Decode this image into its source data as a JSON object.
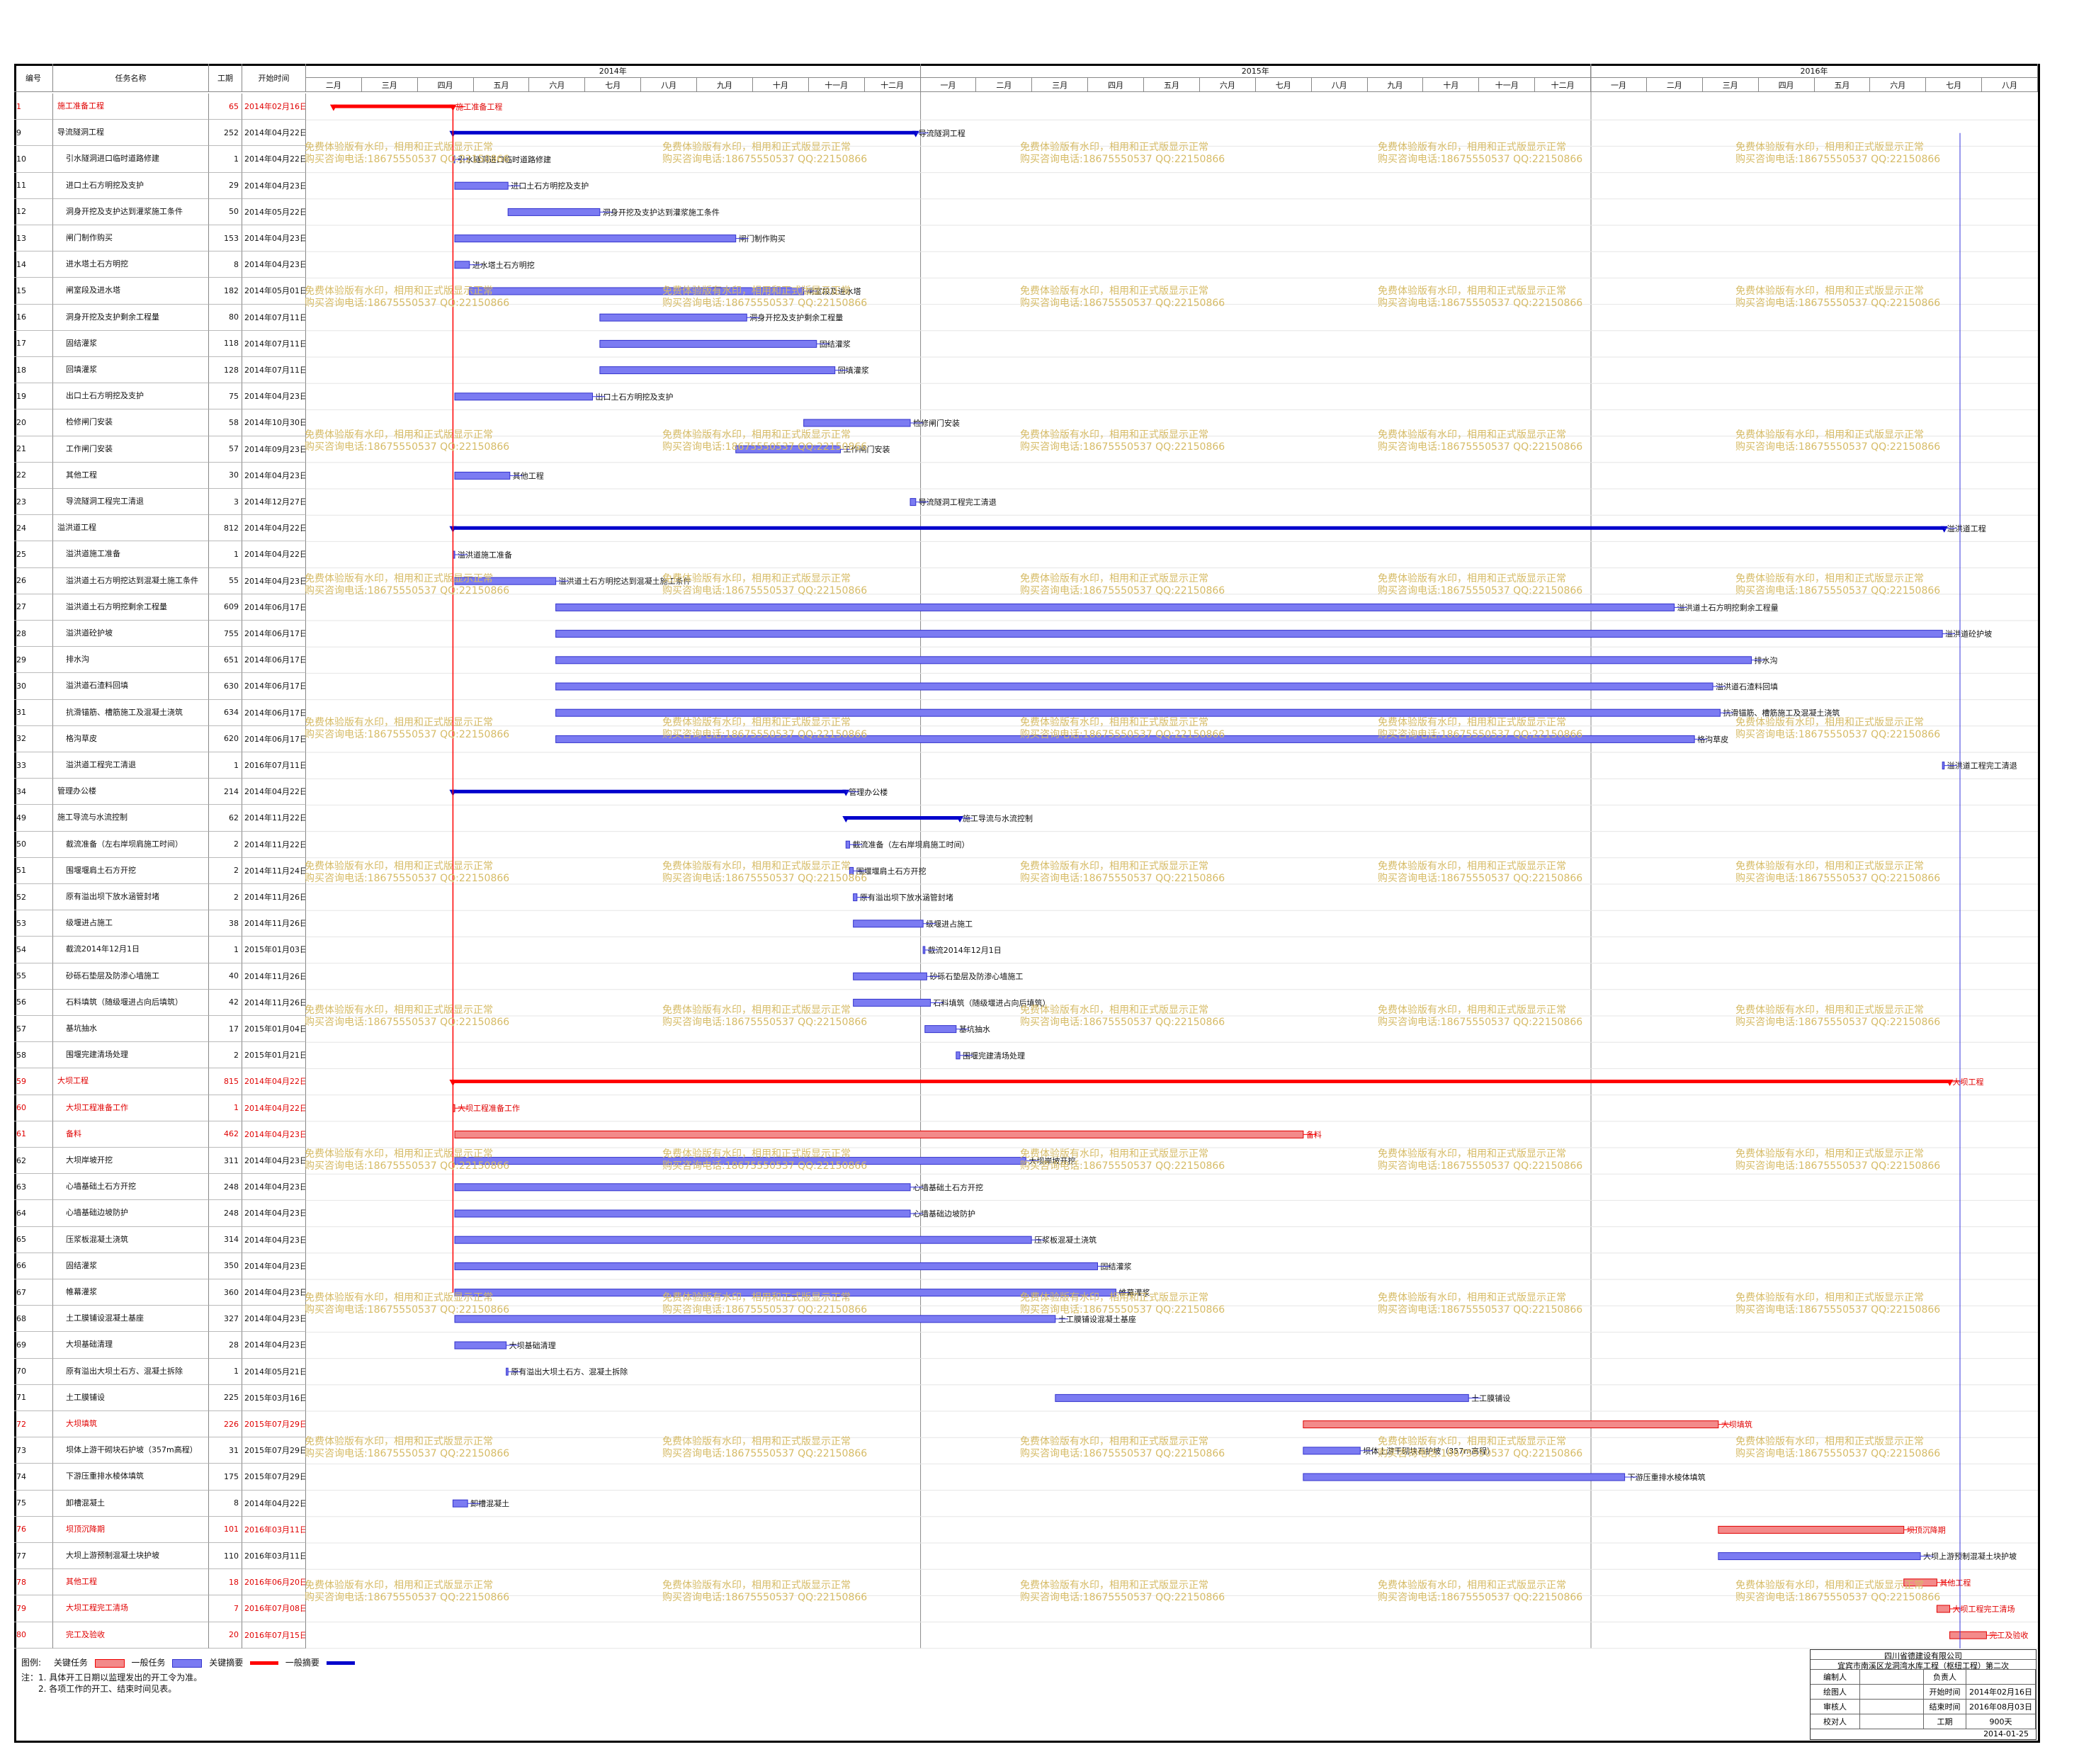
{
  "table_headers": {
    "id": "编号",
    "name": "任务名称",
    "duration": "工期",
    "start": "开始时间"
  },
  "timeline": {
    "years": [
      "2014年",
      "2015年",
      "2016年"
    ],
    "months_2014": [
      "二月",
      "三月",
      "四月",
      "五月",
      "六月",
      "七月",
      "八月",
      "九月",
      "十月",
      "十一月",
      "十二月"
    ],
    "months_2015": [
      "一月",
      "二月",
      "三月",
      "四月",
      "五月",
      "六月",
      "七月",
      "八月",
      "九月",
      "十月",
      "十一月",
      "十二月"
    ],
    "months_2016": [
      "一月",
      "二月",
      "三月",
      "四月",
      "五月",
      "六月",
      "七月",
      "八月"
    ]
  },
  "tasks": [
    {
      "id": "1",
      "name": "施工准备工程",
      "dur": "65",
      "start": "2014年02月16日",
      "crit": true,
      "label": "施工准备工程"
    },
    {
      "id": "9",
      "name": "导流隧洞工程",
      "dur": "252",
      "start": "2014年04月22日",
      "crit": false,
      "label": "导流隧洞工程"
    },
    {
      "id": "10",
      "name": "引水隧洞进口临时道路修建",
      "dur": "1",
      "start": "2014年04月22日",
      "crit": false,
      "label": "引水隧洞进口临时道路修建"
    },
    {
      "id": "11",
      "name": "进口土石方明挖及支护",
      "dur": "29",
      "start": "2014年04月23日",
      "crit": false,
      "label": "进口土石方明挖及支护"
    },
    {
      "id": "12",
      "name": "洞身开挖及支护达到灌浆施工条件",
      "dur": "50",
      "start": "2014年05月22日",
      "crit": false,
      "label": "洞身开挖及支护达到灌浆施工条件"
    },
    {
      "id": "13",
      "name": "闸门制作购买",
      "dur": "153",
      "start": "2014年04月23日",
      "crit": false,
      "label": "闸门制作购买"
    },
    {
      "id": "14",
      "name": "进水塔土石方明挖",
      "dur": "8",
      "start": "2014年04月23日",
      "crit": false,
      "label": "进水塔土石方明挖"
    },
    {
      "id": "15",
      "name": "闸室段及进水塔",
      "dur": "182",
      "start": "2014年05月01日",
      "crit": false,
      "label": "闸室段及进水塔"
    },
    {
      "id": "16",
      "name": "洞身开挖及支护剩余工程量",
      "dur": "80",
      "start": "2014年07月11日",
      "crit": false,
      "label": "洞身开挖及支护剩余工程量"
    },
    {
      "id": "17",
      "name": "固结灌浆",
      "dur": "118",
      "start": "2014年07月11日",
      "crit": false,
      "label": "固结灌浆"
    },
    {
      "id": "18",
      "name": "回填灌浆",
      "dur": "128",
      "start": "2014年07月11日",
      "crit": false,
      "label": "回填灌浆"
    },
    {
      "id": "19",
      "name": "出口土石方明挖及支护",
      "dur": "75",
      "start": "2014年04月23日",
      "crit": false,
      "label": "出口土石方明挖及支护"
    },
    {
      "id": "20",
      "name": "检修闸门安装",
      "dur": "58",
      "start": "2014年10月30日",
      "crit": false,
      "label": "检修闸门安装"
    },
    {
      "id": "21",
      "name": "工作闸门安装",
      "dur": "57",
      "start": "2014年09月23日",
      "crit": false,
      "label": "工作闸门安装"
    },
    {
      "id": "22",
      "name": "其他工程",
      "dur": "30",
      "start": "2014年04月23日",
      "crit": false,
      "label": "其他工程"
    },
    {
      "id": "23",
      "name": "导流隧洞工程完工清退",
      "dur": "3",
      "start": "2014年12月27日",
      "crit": false,
      "label": "导流隧洞工程完工清退"
    },
    {
      "id": "24",
      "name": "溢洪道工程",
      "dur": "812",
      "start": "2014年04月22日",
      "crit": false,
      "label": "溢洪道工程"
    },
    {
      "id": "25",
      "name": "溢洪道施工准备",
      "dur": "1",
      "start": "2014年04月22日",
      "crit": false,
      "label": "溢洪道施工准备"
    },
    {
      "id": "26",
      "name": "溢洪道土石方明挖达到混凝土施工条件",
      "dur": "55",
      "start": "2014年04月23日",
      "crit": false,
      "label": "溢洪道土石方明挖达到混凝土施工条件"
    },
    {
      "id": "27",
      "name": "溢洪道土石方明挖剩余工程量",
      "dur": "609",
      "start": "2014年06月17日",
      "crit": false,
      "label": "溢洪道土石方明挖剩余工程量"
    },
    {
      "id": "28",
      "name": "溢洪道砼护坡",
      "dur": "755",
      "start": "2014年06月17日",
      "crit": false,
      "label": "溢洪道砼护坡"
    },
    {
      "id": "29",
      "name": "排水沟",
      "dur": "651",
      "start": "2014年06月17日",
      "crit": false,
      "label": "排水沟"
    },
    {
      "id": "30",
      "name": "溢洪道石渣料回填",
      "dur": "630",
      "start": "2014年06月17日",
      "crit": false,
      "label": "溢洪道石渣料回填"
    },
    {
      "id": "31",
      "name": "抗滑锚筋、槽筋施工及混凝土浇筑",
      "dur": "634",
      "start": "2014年06月17日",
      "crit": false,
      "label": "抗滑锚筋、槽筋施工及混凝土浇筑"
    },
    {
      "id": "32",
      "name": "格沟草皮",
      "dur": "620",
      "start": "2014年06月17日",
      "crit": false,
      "label": "格沟草皮"
    },
    {
      "id": "33",
      "name": "溢洪道工程完工清退",
      "dur": "1",
      "start": "2016年07月11日",
      "crit": false,
      "label": "溢洪道工程完工清退"
    },
    {
      "id": "34",
      "name": "管理办公楼",
      "dur": "214",
      "start": "2014年04月22日",
      "crit": false,
      "label": "管理办公楼"
    },
    {
      "id": "49",
      "name": "施工导流与水流控制",
      "dur": "62",
      "start": "2014年11月22日",
      "crit": false,
      "label": "施工导流与水流控制"
    },
    {
      "id": "50",
      "name": "截流准备（左右岸坝肩施工时间）",
      "dur": "2",
      "start": "2014年11月22日",
      "crit": false,
      "label": "截流准备（左右岸坝肩施工时间）"
    },
    {
      "id": "51",
      "name": "围堰堰肩土石方开挖",
      "dur": "2",
      "start": "2014年11月24日",
      "crit": false,
      "label": "围堰堰肩土石方开挖"
    },
    {
      "id": "52",
      "name": "原有溢出坝下放水涵管封堵",
      "dur": "2",
      "start": "2014年11月26日",
      "crit": false,
      "label": "原有溢出坝下放水涵管封堵"
    },
    {
      "id": "53",
      "name": "级堰进占施工",
      "dur": "38",
      "start": "2014年11月26日",
      "crit": false,
      "label": "级堰进占施工"
    },
    {
      "id": "54",
      "name": "截流2014年12月1日",
      "dur": "1",
      "start": "2015年01月03日",
      "crit": false,
      "label": "截流2014年12月1日"
    },
    {
      "id": "55",
      "name": "砂砾石垫层及防渗心墙施工",
      "dur": "40",
      "start": "2014年11月26日",
      "crit": false,
      "label": "砂砾石垫层及防渗心墙施工"
    },
    {
      "id": "56",
      "name": "石料填筑（随级堰进占向后填筑）",
      "dur": "42",
      "start": "2014年11月26日",
      "crit": false,
      "label": "石料填筑（随级堰进占向后填筑）"
    },
    {
      "id": "57",
      "name": "基坑抽水",
      "dur": "17",
      "start": "2015年01月04日",
      "crit": false,
      "label": "基坑抽水"
    },
    {
      "id": "58",
      "name": "围堰完建清场处理",
      "dur": "2",
      "start": "2015年01月21日",
      "crit": false,
      "label": "围堰完建清场处理"
    },
    {
      "id": "59",
      "name": "大坝工程",
      "dur": "815",
      "start": "2014年04月22日",
      "crit": true,
      "label": "大坝工程"
    },
    {
      "id": "60",
      "name": "大坝工程准备工作",
      "dur": "1",
      "start": "2014年04月22日",
      "crit": true,
      "label": "大坝工程准备工作"
    },
    {
      "id": "61",
      "name": "备料",
      "dur": "462",
      "start": "2014年04月23日",
      "crit": true,
      "label": "备料"
    },
    {
      "id": "62",
      "name": "大坝岸坡开挖",
      "dur": "311",
      "start": "2014年04月23日",
      "crit": false,
      "label": "大坝岸坡开挖"
    },
    {
      "id": "63",
      "name": "心墙基础土石方开挖",
      "dur": "248",
      "start": "2014年04月23日",
      "crit": false,
      "label": "心墙基础土石方开挖"
    },
    {
      "id": "64",
      "name": "心墙基础边坡防护",
      "dur": "248",
      "start": "2014年04月23日",
      "crit": false,
      "label": "心墙基础边坡防护"
    },
    {
      "id": "65",
      "name": "压浆板混凝土浇筑",
      "dur": "314",
      "start": "2014年04月23日",
      "crit": false,
      "label": "压浆板混凝土浇筑"
    },
    {
      "id": "66",
      "name": "固结灌浆",
      "dur": "350",
      "start": "2014年04月23日",
      "crit": false,
      "label": "固结灌浆"
    },
    {
      "id": "67",
      "name": "帷幕灌浆",
      "dur": "360",
      "start": "2014年04月23日",
      "crit": false,
      "label": "帷幕灌浆"
    },
    {
      "id": "68",
      "name": "土工膜铺设混凝土基座",
      "dur": "327",
      "start": "2014年04月23日",
      "crit": false,
      "label": "土工膜铺设混凝土基座"
    },
    {
      "id": "69",
      "name": "大坝基础清理",
      "dur": "28",
      "start": "2014年04月23日",
      "crit": false,
      "label": "大坝基础清理"
    },
    {
      "id": "70",
      "name": "原有溢出大坝土石方、混凝土拆除",
      "dur": "1",
      "start": "2014年05月21日",
      "crit": false,
      "label": "原有溢出大坝土石方、混凝土拆除"
    },
    {
      "id": "71",
      "name": "土工膜铺设",
      "dur": "225",
      "start": "2015年03月16日",
      "crit": false,
      "label": "土工膜铺设"
    },
    {
      "id": "72",
      "name": "大坝填筑",
      "dur": "226",
      "start": "2015年07月29日",
      "crit": true,
      "label": "大坝填筑"
    },
    {
      "id": "73",
      "name": "坝体上游干砌块石护坡（357m高程）",
      "dur": "31",
      "start": "2015年07月29日",
      "crit": false,
      "label": "坝体上游干砌块石护坡（357m高程）"
    },
    {
      "id": "74",
      "name": "下游压重排水棱体填筑",
      "dur": "175",
      "start": "2015年07月29日",
      "crit": false,
      "label": "下游压重排水棱体填筑"
    },
    {
      "id": "75",
      "name": "卸槽混凝土",
      "dur": "8",
      "start": "2014年04月22日",
      "crit": false,
      "label": "卸槽混凝土"
    },
    {
      "id": "76",
      "name": "坝顶沉降期",
      "dur": "101",
      "start": "2016年03月11日",
      "crit": true,
      "label": "坝顶沉降期"
    },
    {
      "id": "77",
      "name": "大坝上游预制混凝土块护坡",
      "dur": "110",
      "start": "2016年03月11日",
      "crit": false,
      "label": "大坝上游预制混凝土块护坡"
    },
    {
      "id": "78",
      "name": "其他工程",
      "dur": "18",
      "start": "2016年06月20日",
      "crit": true,
      "label": "其他工程"
    },
    {
      "id": "79",
      "name": "大坝工程完工清场",
      "dur": "7",
      "start": "2016年07月08日",
      "crit": true,
      "label": "大坝工程完工清场"
    },
    {
      "id": "80",
      "name": "完工及验收",
      "dur": "20",
      "start": "2016年07月15日",
      "crit": true,
      "label": "完工及验收"
    }
  ],
  "watermark": {
    "line1": "免费体验版有水印，相用和正式版显示正常",
    "line2": "购买咨询电话:18675550537 QQ:22150866"
  },
  "legend": {
    "title": "图例:",
    "critical_task": "关键任务",
    "normal_task": "一般任务",
    "critical_summary": "关键摘要",
    "normal_summary": "一般摘要"
  },
  "notes": {
    "line1": "注：1. 具体开工日期以监理发出的开工令为准。",
    "line2": "　　2. 各项工作的开工、结束时间见表。"
  },
  "title_block": {
    "company": "四川省德建设有限公司",
    "project": "宜宾市南溪区龙洞湾水库工程（枢纽工程）第二次",
    "rows": [
      {
        "k1": "编制人",
        "v1": "",
        "k2": "负责人",
        "v2": ""
      },
      {
        "k1": "绘图人",
        "v1": "",
        "k2": "开始时间",
        "v2": "2014年02月16日"
      },
      {
        "k1": "审核人",
        "v1": "",
        "k2": "结束时间",
        "v2": "2016年08月03日"
      },
      {
        "k1": "校对人",
        "v1": "",
        "k2": "工期",
        "v2": "900天"
      }
    ],
    "date": "2014-01-25"
  },
  "colors": {
    "critical": "#ff0000",
    "critical_bar": "#f38a8a",
    "normal_bar": "#7b7bf2",
    "summary": "#0000cc",
    "link": "#3333dd",
    "watermark": "#d6bb66"
  }
}
